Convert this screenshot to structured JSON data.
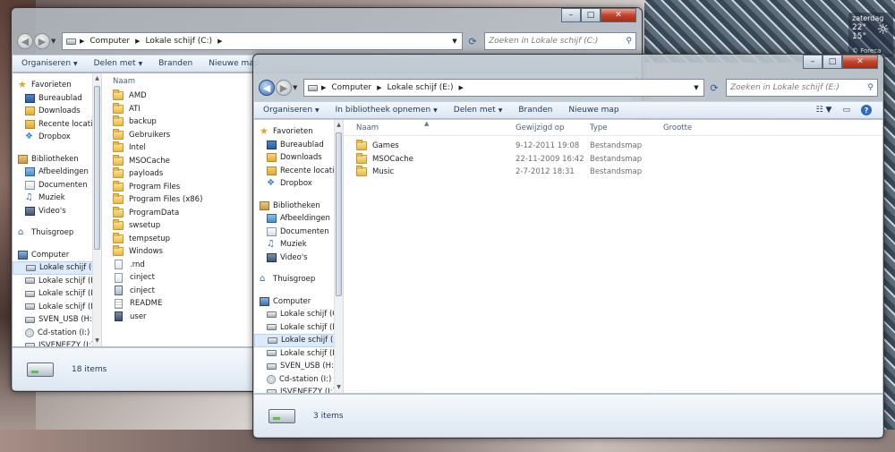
{
  "gadget": {
    "day": "zaterdag",
    "temp_now": "22°",
    "temp_low": "15°",
    "source": "© Foreca"
  },
  "back_window": {
    "address": [
      "Computer",
      "Lokale schijf (C:)"
    ],
    "search_placeholder": "Zoeken in Lokale schijf (C:)",
    "toolbar": {
      "organize": "Organiseren",
      "share": "Delen met",
      "burn": "Branden",
      "new_folder": "Nieuwe map"
    },
    "nav": {
      "favorites": "Favorieten",
      "fav_items": [
        "Bureaublad",
        "Downloads",
        "Recente locaties",
        "Dropbox"
      ],
      "libraries": "Bibliotheken",
      "lib_items": [
        "Afbeeldingen",
        "Documenten",
        "Muziek",
        "Video's"
      ],
      "homegroup": "Thuisgroep",
      "computer": "Computer",
      "drives": [
        "Lokale schijf (C:)",
        "Lokale schijf (D:)",
        "Lokale schijf (E:)",
        "Lokale schijf (F:)",
        "SVEN_USB (H:)",
        "Cd-station (I:)",
        "JSVENEEZY (J:)"
      ]
    },
    "column_name": "Naam",
    "files": [
      {
        "name": "AMD",
        "kind": "folder"
      },
      {
        "name": "ATI",
        "kind": "folder"
      },
      {
        "name": "backup",
        "kind": "folder"
      },
      {
        "name": "Gebruikers",
        "kind": "folder"
      },
      {
        "name": "Intel",
        "kind": "folder"
      },
      {
        "name": "MSOCache",
        "kind": "folder"
      },
      {
        "name": "payloads",
        "kind": "folder"
      },
      {
        "name": "Program Files",
        "kind": "folder"
      },
      {
        "name": "Program Files (x86)",
        "kind": "folder"
      },
      {
        "name": "ProgramData",
        "kind": "folder"
      },
      {
        "name": "swsetup",
        "kind": "folder"
      },
      {
        "name": "tempsetup",
        "kind": "folder"
      },
      {
        "name": "Windows",
        "kind": "folder"
      },
      {
        "name": ".rnd",
        "kind": "sys"
      },
      {
        "name": "cinject",
        "kind": "sys"
      },
      {
        "name": "cinject",
        "kind": "bat"
      },
      {
        "name": "README",
        "kind": "txt"
      },
      {
        "name": "user",
        "kind": "user"
      }
    ],
    "status": "18 items"
  },
  "front_window": {
    "address": [
      "Computer",
      "Lokale schijf (E:)"
    ],
    "search_placeholder": "Zoeken in Lokale schijf (E:)",
    "toolbar": {
      "organize": "Organiseren",
      "include_library": "In bibliotheek opnemen",
      "share": "Delen met",
      "burn": "Branden",
      "new_folder": "Nieuwe map"
    },
    "nav": {
      "favorites": "Favorieten",
      "fav_items": [
        "Bureaublad",
        "Downloads",
        "Recente locaties",
        "Dropbox"
      ],
      "libraries": "Bibliotheken",
      "lib_items": [
        "Afbeeldingen",
        "Documenten",
        "Muziek",
        "Video's"
      ],
      "homegroup": "Thuisgroep",
      "computer": "Computer",
      "drives": [
        "Lokale schijf (C:)",
        "Lokale schijf (D:)",
        "Lokale schijf (E:)",
        "Lokale schijf (F:)",
        "SVEN_USB (H:)",
        "Cd-station (I:)",
        "JSVENEEZY (J:)"
      ]
    },
    "columns": {
      "name": "Naam",
      "modified": "Gewijzigd op",
      "type": "Type",
      "size": "Grootte"
    },
    "files": [
      {
        "name": "Games",
        "modified": "9-12-2011 19:08",
        "type": "Bestandsmap"
      },
      {
        "name": "MSOCache",
        "modified": "22-11-2009 16:42",
        "type": "Bestandsmap"
      },
      {
        "name": "Music",
        "modified": "2-7-2012 18:31",
        "type": "Bestandsmap"
      }
    ],
    "status": "3 items"
  }
}
